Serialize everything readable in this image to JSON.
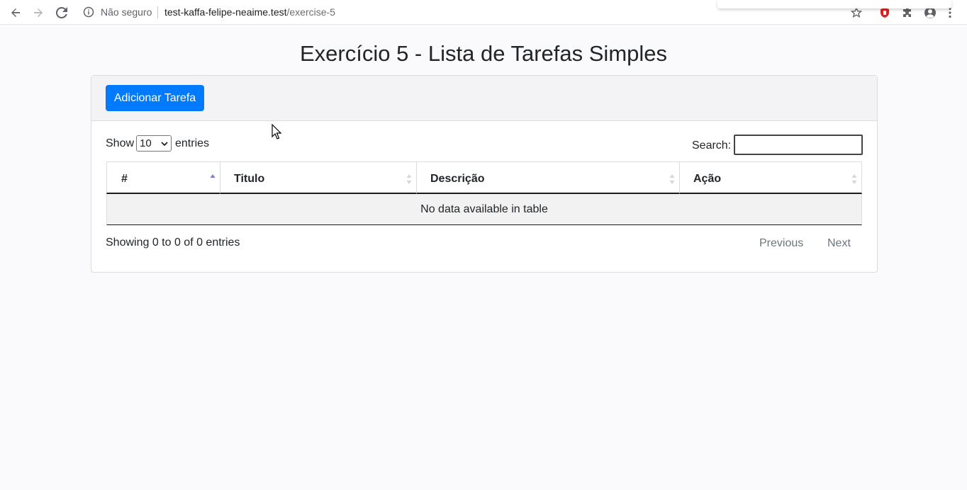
{
  "browser": {
    "security_label": "Não seguro",
    "url_host": "test-kaffa-felipe-neaime.test",
    "url_path": "/exercise-5",
    "icons": [
      "back-icon",
      "forward-icon",
      "reload-icon",
      "info-icon",
      "star-icon",
      "shield-icon",
      "extensions-icon",
      "profile-icon",
      "menu-icon"
    ]
  },
  "page": {
    "title": "Exercício 5 - Lista de Tarefas Simples",
    "add_button_label": "Adicionar Tarefa"
  },
  "datatable": {
    "show_label": "Show",
    "entries_label": "entries",
    "page_length": "10",
    "search_label": "Search:",
    "search_value": "",
    "columns": [
      "#",
      "Titulo",
      "Descrição",
      "Ação"
    ],
    "sorted_column": "#",
    "sort_direction": "ascending",
    "empty_message": "No data available in table",
    "info": "Showing 0 to 0 of 0 entries",
    "previous_label": "Previous",
    "next_label": "Next"
  },
  "colors": {
    "primary": "#007bff",
    "muted": "#6c757d",
    "sort_active": "#7b7bd6"
  }
}
